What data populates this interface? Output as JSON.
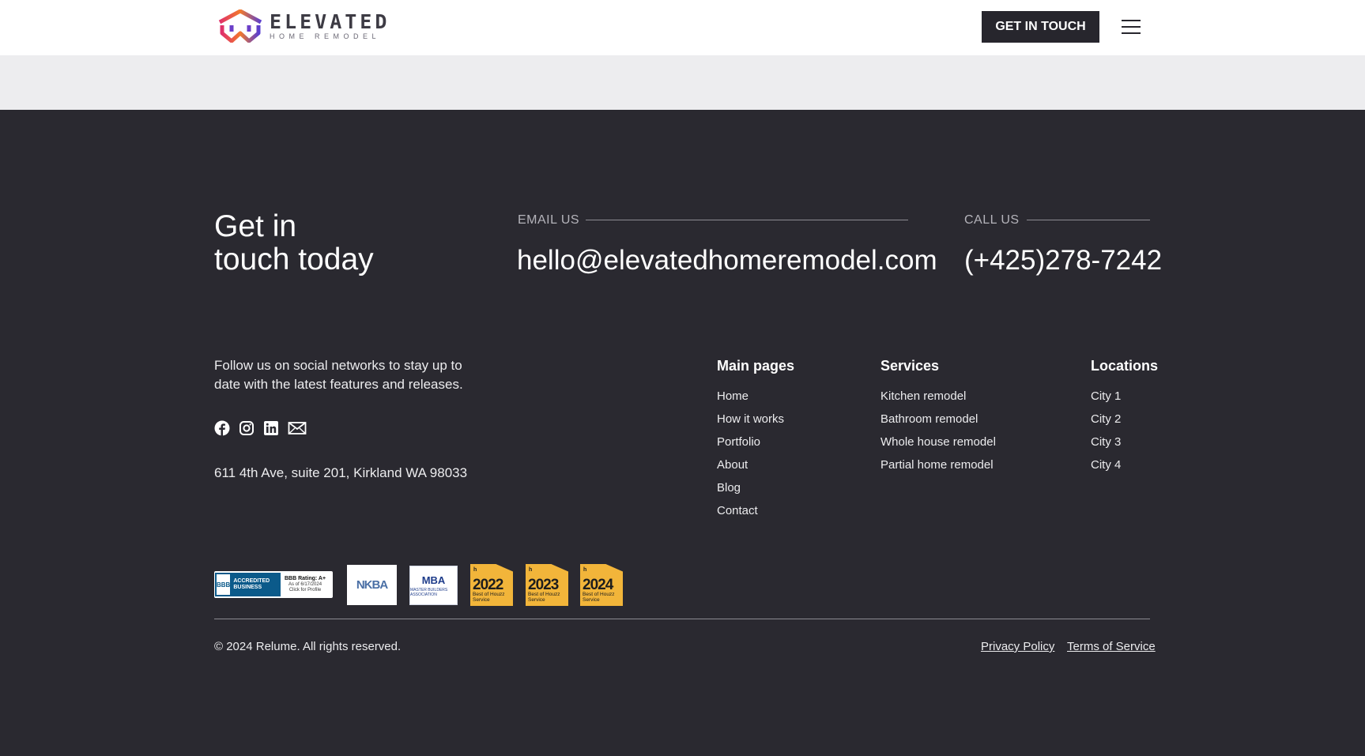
{
  "header": {
    "brand": {
      "name": "ELEVATED",
      "tagline": "HOME REMODEL",
      "logo_icon": "elevated-logo-mark"
    },
    "cta_label": "GET IN TOUCH",
    "menu_icon": "hamburger-menu-icon"
  },
  "contact": {
    "heading_line1": "Get in",
    "heading_line2": "touch today",
    "email_label": "EMAIL US",
    "email_value": "hello@elevatedhomeremodel.com",
    "phone_label": "CALL US",
    "phone_value": "(+425)278-7242"
  },
  "social": {
    "text": "Follow us on social networks to stay up to date with the latest features and releases.",
    "icons": [
      "facebook-icon",
      "instagram-icon",
      "linkedin-icon",
      "mail-icon"
    ]
  },
  "address": "611 4th Ave, suite 201, Kirkland WA 98033",
  "columns": [
    {
      "title": "Main pages",
      "links": [
        "Home",
        "How it works",
        "Portfolio",
        "About",
        "Blog",
        "Contact"
      ]
    },
    {
      "title": "Services",
      "links": [
        "Kitchen remodel",
        "Bathroom remodel",
        "Whole house remodel",
        "Partial home remodel"
      ]
    },
    {
      "title": "Locations",
      "links": [
        "City 1",
        "City 2",
        "City 3",
        "City 4"
      ]
    }
  ],
  "badges": {
    "bbb": {
      "seal": "BBB",
      "accredited": "ACCREDITED BUSINESS",
      "rating": "BBB Rating: A+",
      "date": "As of 6/17/2024",
      "click": "Click for Profile"
    },
    "nkba": "NKBA",
    "mba": {
      "name": "MBA",
      "sub": "MASTER BUILDERS ASSOCIATION"
    },
    "houzz": [
      {
        "logo": "h",
        "year": "2022",
        "caption": "Best of Houzz Service"
      },
      {
        "logo": "h",
        "year": "2023",
        "caption": "Best of Houzz Service"
      },
      {
        "logo": "h",
        "year": "2024",
        "caption": "Best of Houzz Service"
      }
    ]
  },
  "footer": {
    "copyright": "© 2024 Relume. All rights reserved.",
    "privacy": "Privacy Policy",
    "terms": "Terms of Service"
  },
  "colors": {
    "background_dark": "#2a2930",
    "header_bg": "#ffffff",
    "band_bg": "#ededef",
    "button_bg": "#27262d",
    "houzz_gold": "#f2b53a"
  }
}
